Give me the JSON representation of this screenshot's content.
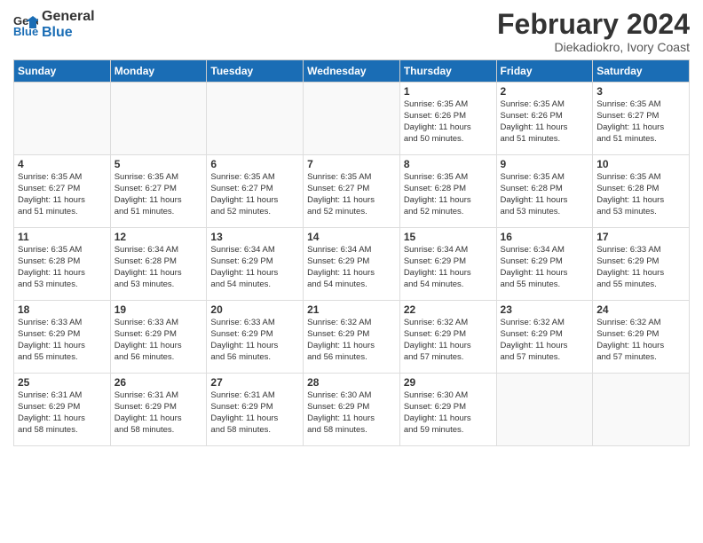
{
  "header": {
    "logo_line1": "General",
    "logo_line2": "Blue",
    "month_title": "February 2024",
    "location": "Diekadiokro, Ivory Coast"
  },
  "weekdays": [
    "Sunday",
    "Monday",
    "Tuesday",
    "Wednesday",
    "Thursday",
    "Friday",
    "Saturday"
  ],
  "weeks": [
    [
      {
        "day": "",
        "info": ""
      },
      {
        "day": "",
        "info": ""
      },
      {
        "day": "",
        "info": ""
      },
      {
        "day": "",
        "info": ""
      },
      {
        "day": "1",
        "info": "Sunrise: 6:35 AM\nSunset: 6:26 PM\nDaylight: 11 hours\nand 50 minutes."
      },
      {
        "day": "2",
        "info": "Sunrise: 6:35 AM\nSunset: 6:26 PM\nDaylight: 11 hours\nand 51 minutes."
      },
      {
        "day": "3",
        "info": "Sunrise: 6:35 AM\nSunset: 6:27 PM\nDaylight: 11 hours\nand 51 minutes."
      }
    ],
    [
      {
        "day": "4",
        "info": "Sunrise: 6:35 AM\nSunset: 6:27 PM\nDaylight: 11 hours\nand 51 minutes."
      },
      {
        "day": "5",
        "info": "Sunrise: 6:35 AM\nSunset: 6:27 PM\nDaylight: 11 hours\nand 51 minutes."
      },
      {
        "day": "6",
        "info": "Sunrise: 6:35 AM\nSunset: 6:27 PM\nDaylight: 11 hours\nand 52 minutes."
      },
      {
        "day": "7",
        "info": "Sunrise: 6:35 AM\nSunset: 6:27 PM\nDaylight: 11 hours\nand 52 minutes."
      },
      {
        "day": "8",
        "info": "Sunrise: 6:35 AM\nSunset: 6:28 PM\nDaylight: 11 hours\nand 52 minutes."
      },
      {
        "day": "9",
        "info": "Sunrise: 6:35 AM\nSunset: 6:28 PM\nDaylight: 11 hours\nand 53 minutes."
      },
      {
        "day": "10",
        "info": "Sunrise: 6:35 AM\nSunset: 6:28 PM\nDaylight: 11 hours\nand 53 minutes."
      }
    ],
    [
      {
        "day": "11",
        "info": "Sunrise: 6:35 AM\nSunset: 6:28 PM\nDaylight: 11 hours\nand 53 minutes."
      },
      {
        "day": "12",
        "info": "Sunrise: 6:34 AM\nSunset: 6:28 PM\nDaylight: 11 hours\nand 53 minutes."
      },
      {
        "day": "13",
        "info": "Sunrise: 6:34 AM\nSunset: 6:29 PM\nDaylight: 11 hours\nand 54 minutes."
      },
      {
        "day": "14",
        "info": "Sunrise: 6:34 AM\nSunset: 6:29 PM\nDaylight: 11 hours\nand 54 minutes."
      },
      {
        "day": "15",
        "info": "Sunrise: 6:34 AM\nSunset: 6:29 PM\nDaylight: 11 hours\nand 54 minutes."
      },
      {
        "day": "16",
        "info": "Sunrise: 6:34 AM\nSunset: 6:29 PM\nDaylight: 11 hours\nand 55 minutes."
      },
      {
        "day": "17",
        "info": "Sunrise: 6:33 AM\nSunset: 6:29 PM\nDaylight: 11 hours\nand 55 minutes."
      }
    ],
    [
      {
        "day": "18",
        "info": "Sunrise: 6:33 AM\nSunset: 6:29 PM\nDaylight: 11 hours\nand 55 minutes."
      },
      {
        "day": "19",
        "info": "Sunrise: 6:33 AM\nSunset: 6:29 PM\nDaylight: 11 hours\nand 56 minutes."
      },
      {
        "day": "20",
        "info": "Sunrise: 6:33 AM\nSunset: 6:29 PM\nDaylight: 11 hours\nand 56 minutes."
      },
      {
        "day": "21",
        "info": "Sunrise: 6:32 AM\nSunset: 6:29 PM\nDaylight: 11 hours\nand 56 minutes."
      },
      {
        "day": "22",
        "info": "Sunrise: 6:32 AM\nSunset: 6:29 PM\nDaylight: 11 hours\nand 57 minutes."
      },
      {
        "day": "23",
        "info": "Sunrise: 6:32 AM\nSunset: 6:29 PM\nDaylight: 11 hours\nand 57 minutes."
      },
      {
        "day": "24",
        "info": "Sunrise: 6:32 AM\nSunset: 6:29 PM\nDaylight: 11 hours\nand 57 minutes."
      }
    ],
    [
      {
        "day": "25",
        "info": "Sunrise: 6:31 AM\nSunset: 6:29 PM\nDaylight: 11 hours\nand 58 minutes."
      },
      {
        "day": "26",
        "info": "Sunrise: 6:31 AM\nSunset: 6:29 PM\nDaylight: 11 hours\nand 58 minutes."
      },
      {
        "day": "27",
        "info": "Sunrise: 6:31 AM\nSunset: 6:29 PM\nDaylight: 11 hours\nand 58 minutes."
      },
      {
        "day": "28",
        "info": "Sunrise: 6:30 AM\nSunset: 6:29 PM\nDaylight: 11 hours\nand 58 minutes."
      },
      {
        "day": "29",
        "info": "Sunrise: 6:30 AM\nSunset: 6:29 PM\nDaylight: 11 hours\nand 59 minutes."
      },
      {
        "day": "",
        "info": ""
      },
      {
        "day": "",
        "info": ""
      }
    ]
  ]
}
